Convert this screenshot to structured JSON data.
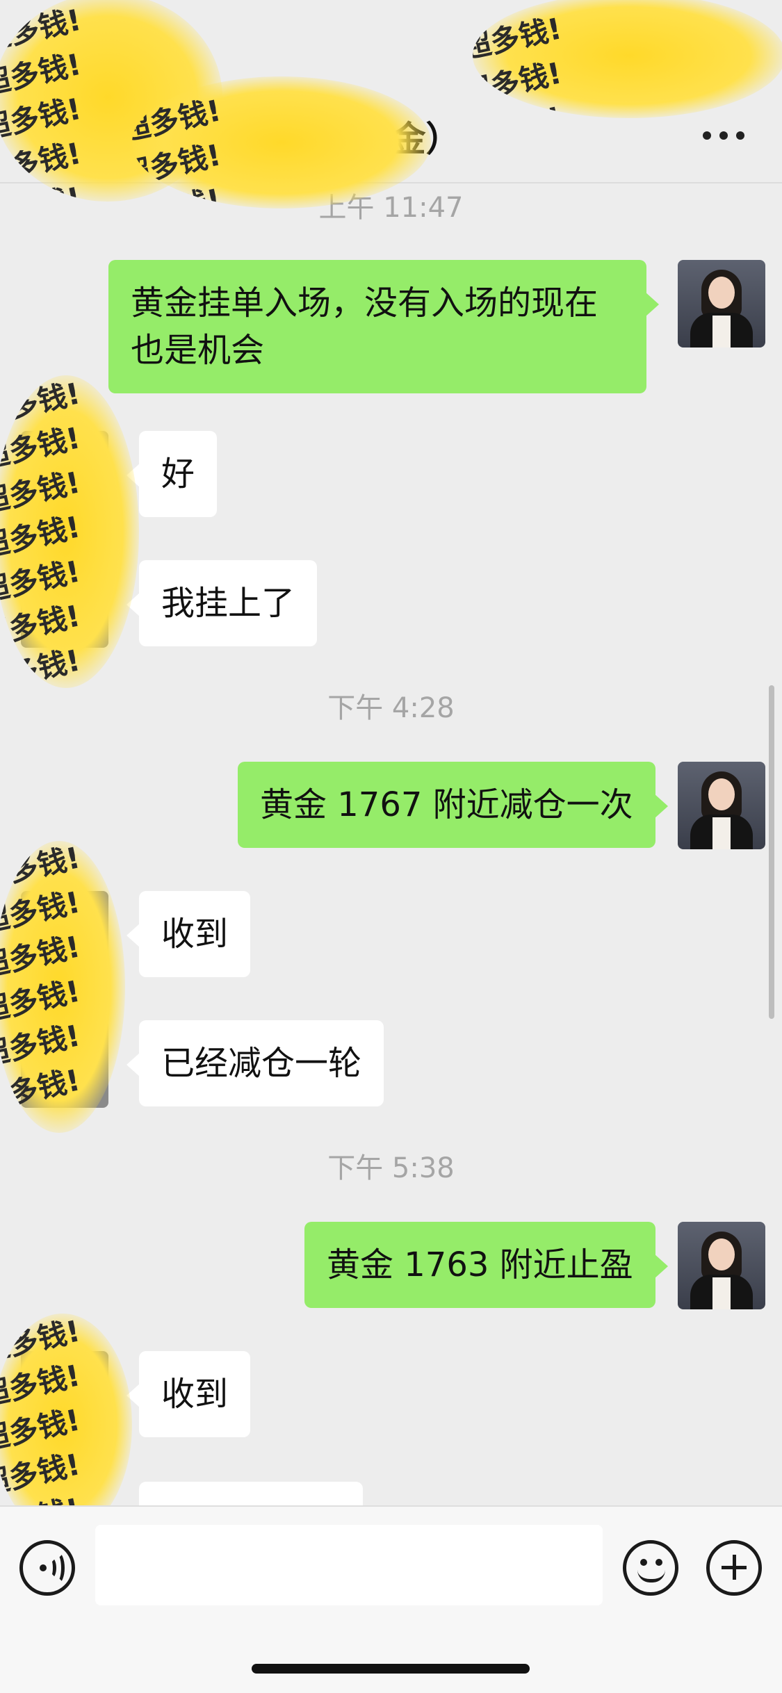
{
  "header": {
    "title": "万美金）",
    "more_icon": "more-dots-icon"
  },
  "messages": [
    {
      "type": "timestamp",
      "text": "上午 11:47"
    },
    {
      "type": "out",
      "lines": [
        "黄金挂单入场，没有入场的现在",
        "也是机会"
      ]
    },
    {
      "type": "in",
      "text": "好"
    },
    {
      "type": "in",
      "text": "我挂上了"
    },
    {
      "type": "timestamp",
      "text": "下午 4:28"
    },
    {
      "type": "out",
      "text": "黄金 1767 附近减仓一次"
    },
    {
      "type": "in",
      "text": "收到"
    },
    {
      "type": "in",
      "text": "已经减仓一轮"
    },
    {
      "type": "timestamp",
      "text": "下午 5:38"
    },
    {
      "type": "out",
      "text": "黄金 1763 附近止盈"
    },
    {
      "type": "in",
      "text": "收到"
    }
  ],
  "sticker_text": "超多钱!",
  "input_bar": {
    "voice_icon": "voice-icon",
    "input_value": "",
    "emoji_icon": "emoji-icon",
    "plus_icon": "plus-icon"
  },
  "colors": {
    "outgoing_bubble": "#95ec69",
    "incoming_bubble": "#ffffff",
    "background": "#ededed",
    "sticker": "#ffd92a"
  }
}
